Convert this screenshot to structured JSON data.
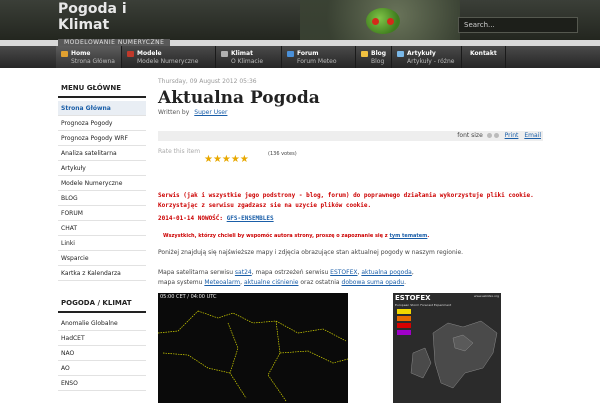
{
  "site": {
    "title": "Pogoda i Klimat",
    "tagline": "MODELOWANIE NUMERYCZNE",
    "search_placeholder": "Search..."
  },
  "nav": [
    {
      "label": "Home",
      "sub": "Strona Główna",
      "icon": "home-icon",
      "icon_color": "#e0a030"
    },
    {
      "label": "Modele",
      "sub": "Modele Numeryczne",
      "icon": "models-icon",
      "icon_color": "#c0392b"
    },
    {
      "label": "Klimat",
      "sub": "O Klimacie",
      "icon": "climate-icon",
      "icon_color": "#b0b0b0"
    },
    {
      "label": "Forum",
      "sub": "Forum Meteo",
      "icon": "forum-icon",
      "icon_color": "#4a90d9"
    },
    {
      "label": "Blog",
      "sub": "Blog",
      "icon": "blog-icon",
      "icon_color": "#f0c040"
    },
    {
      "label": "Artykuły",
      "sub": "Artykuły - różne",
      "icon": "articles-icon",
      "icon_color": "#7ab8e8"
    },
    {
      "label": "Kontakt",
      "sub": "",
      "icon": "",
      "icon_color": ""
    }
  ],
  "sidebar": {
    "heading": "MENU GŁÓWNE",
    "items": [
      {
        "label": "Strona Główna",
        "active": true
      },
      {
        "label": "Prognoza Pogody"
      },
      {
        "label": "Prognoza Pogody WRF"
      },
      {
        "label": "Analiza satelitarna"
      },
      {
        "label": "Artykuły"
      },
      {
        "label": "Modele Numeryczne"
      },
      {
        "label": "BLOG"
      },
      {
        "label": "FORUM"
      },
      {
        "label": "CHAT"
      },
      {
        "label": "Linki"
      },
      {
        "label": "Wsparcie"
      },
      {
        "label": "Kartka z Kalendarza"
      }
    ],
    "heading2": "POGODA / KLIMAT",
    "items2": [
      {
        "label": "Anomalie Globalne"
      },
      {
        "label": "HadCET"
      },
      {
        "label": "NAO"
      },
      {
        "label": "AO"
      },
      {
        "label": "ENSO"
      }
    ]
  },
  "article": {
    "date": "Thursday, 09 August 2012 05:36",
    "title": "Aktualna Pogoda",
    "written_by": "Written by",
    "author": "Super User",
    "font_size_label": "font size",
    "print_label": "Print",
    "email_label": "Email",
    "rate_label": "Rate this item",
    "stars": "★★★★★",
    "votes": "(136 votes)",
    "notice_line1": "Serwis (jak i wszystkie jego podstrony - blog, forum) do poprawnego działania wykorzystuje pliki cookie.",
    "notice_line2": "Korzystając z serwisu zgadzasz sie na uzycie plików cookie.",
    "news_prefix": "2014-01-14 NOWOŚĆ:",
    "news_link": "GFS-ENSEMBLES",
    "thanks_text": "Wszystkich, którzy chcieli by wspomóc autora strony, proszę o zapoznanie się z",
    "thanks_link": "tym tematem",
    "intro": "Poniżej znajdują się najświeższe mapy i zdjęcia obrazujące stan aktualnej pogody w naszym regionie.",
    "maps": {
      "t1": "Mapa satelitarna serwisu",
      "l1": "sat24",
      "t2": ", mapa ostrzeżeń serwisu",
      "l2": "ESTOFEX",
      "t3": ",",
      "l3": "aktualna pogoda",
      "t4": ", mapa systemu",
      "l4": "Meteoalarm",
      "t5": ",",
      "l5": "aktualne ciśnienie",
      "t6": "oraz ostatnia",
      "l6": "dobowa suma opadu",
      "t7": "."
    },
    "sat_label": "05:00 CET / 04:00 UTC",
    "estofex_title": "ESTOFEX",
    "estofex_sub": "European Storm Forecast Experiment",
    "estofex_url": "www.estofex.org"
  }
}
